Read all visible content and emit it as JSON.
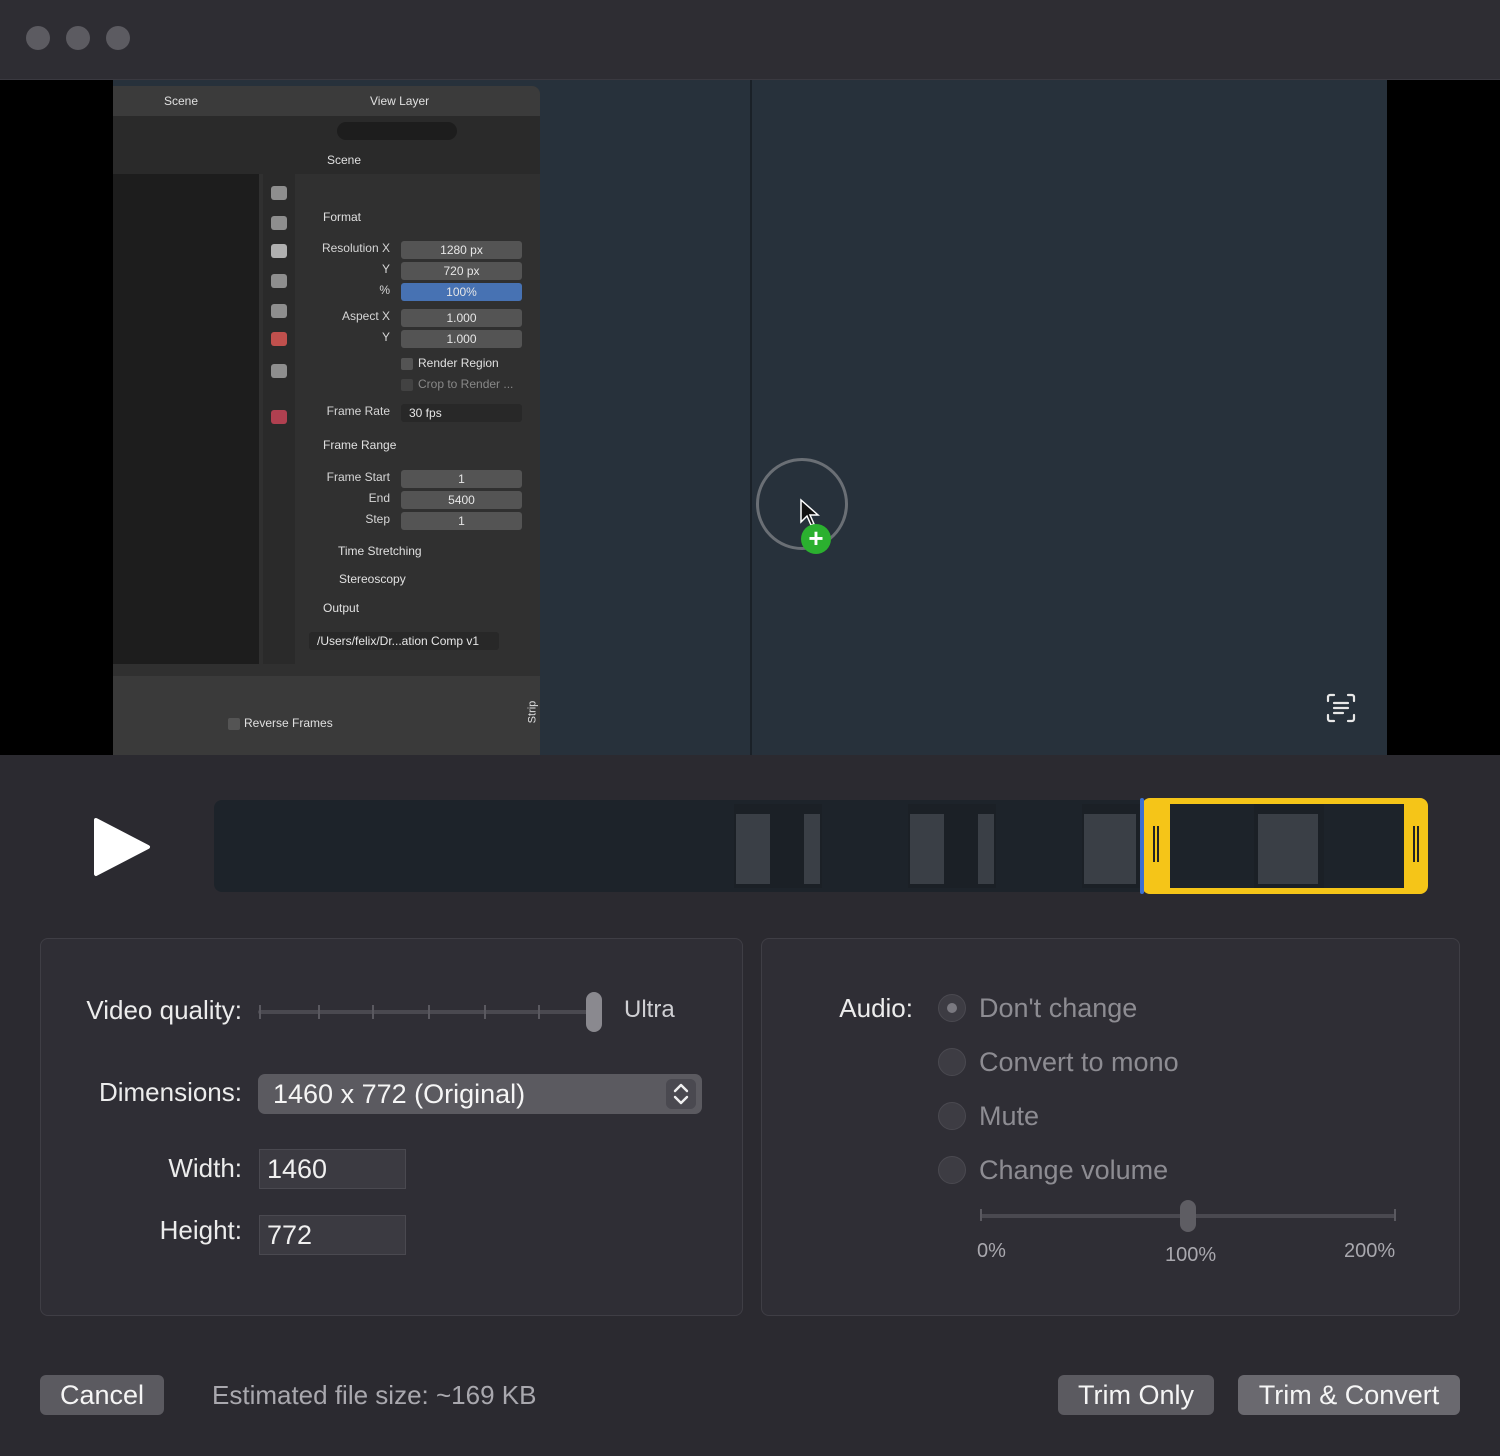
{
  "window": {
    "controls": [
      "close",
      "minimize",
      "zoom"
    ]
  },
  "blender": {
    "scene_label": "Scene",
    "view_layer_label": "View Layer",
    "properties_title": "Scene",
    "format_section": "Format",
    "resolution_x_label": "Resolution X",
    "resolution_x": "1280 px",
    "y_label": "Y",
    "resolution_y": "720 px",
    "percent_label": "%",
    "percent": "100%",
    "aspect_x_label": "Aspect X",
    "aspect_x": "1.000",
    "aspect_y": "1.000",
    "render_region": "Render Region",
    "crop_to_render": "Crop to Render ...",
    "frame_rate_label": "Frame Rate",
    "frame_rate": "30 fps",
    "frame_range_section": "Frame Range",
    "frame_start_label": "Frame Start",
    "frame_start": "1",
    "end_label": "End",
    "end": "5400",
    "step_label": "Step",
    "step": "1",
    "time_stretching": "Time Stretching",
    "stereoscopy": "Stereoscopy",
    "output_section": "Output",
    "output_path": "/Users/felix/Dr...ation Comp v1",
    "reverse_frames": "Reverse Frames",
    "strip_tab": "Strip"
  },
  "quality": {
    "label": "Video quality:",
    "value": "Ultra",
    "level": 1.0
  },
  "dimensions": {
    "label": "Dimensions:",
    "selected": "1460 x 772  (Original)",
    "width_label": "Width:",
    "width": "1460",
    "height_label": "Height:",
    "height": "772"
  },
  "audio": {
    "label": "Audio:",
    "options": [
      "Don't change",
      "Convert to mono",
      "Mute",
      "Change volume"
    ],
    "selected_index": 0,
    "volume_ticks": [
      "0%",
      "100%",
      "200%"
    ],
    "volume_level": 0.5
  },
  "footer": {
    "cancel": "Cancel",
    "estimate": "Estimated file size: ~169 KB",
    "trim_only": "Trim Only",
    "trim_convert": "Trim & Convert"
  },
  "icons": {
    "play": "play-icon",
    "live_text": "live-text-icon",
    "stepper": "chevron-up-down-icon"
  }
}
